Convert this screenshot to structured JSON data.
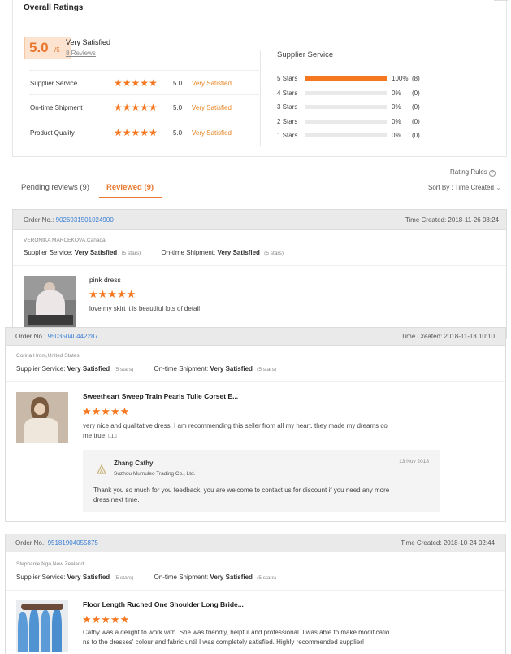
{
  "overall": {
    "title": "Overall Ratings",
    "score": "5.0",
    "score_suffix": "/5",
    "verdict": "Very Satisfied",
    "reviews_count": "8 Reviews",
    "dimensions": [
      {
        "label": "Supplier Service",
        "stars": "★★★★★",
        "value": "5.0",
        "verdict": "Very Satisfied"
      },
      {
        "label": "On-time Shipment",
        "stars": "★★★★★",
        "value": "5.0",
        "verdict": "Very Satisfied"
      },
      {
        "label": "Product Quality",
        "stars": "★★★★★",
        "value": "5.0",
        "verdict": "Very Satisfied"
      }
    ]
  },
  "supplier_service": {
    "title": "Supplier Service",
    "rows": [
      {
        "label": "5 Stars",
        "fraction": 1.0,
        "pct": "100%",
        "count": "(8)"
      },
      {
        "label": "4 Stars",
        "fraction": 0,
        "pct": "0%",
        "count": "(0)"
      },
      {
        "label": "3 Stars",
        "fraction": 0,
        "pct": "0%",
        "count": "(0)"
      },
      {
        "label": "2 Stars",
        "fraction": 0,
        "pct": "0%",
        "count": "(0)"
      },
      {
        "label": "1 Stars",
        "fraction": 0,
        "pct": "0%",
        "count": "(0)"
      }
    ]
  },
  "rating_rules": "Rating Rules",
  "rating_rules_icon": "?",
  "tabs": {
    "pending": "Pending reviews (9)",
    "reviewed": "Reviewed (9)"
  },
  "sort": {
    "label": "Sort By : Time Created",
    "chevron": "⌄"
  },
  "reviews": [
    {
      "order_label": "Order No.:",
      "order_no": "9026931501024900",
      "time": "Time Created: 2018-11-26 08:24",
      "reviewer": "VERONIKA MARCEKOVA,Canada",
      "ss_label": "Supplier Service:",
      "ss_value": "Very Satisfied",
      "ss_stars": "(5 stars)",
      "os_label": "On-time Shipment:",
      "os_value": "Very Satisfied",
      "os_stars": "(5 stars)",
      "product": "pink dress",
      "stars": "★★★★★",
      "comment": "love my skirt it is beautiful lots of detail"
    },
    {
      "order_label": "Order No.:",
      "order_no": "95035040442287",
      "time": "Time Created: 2018-11-13 10:10",
      "reviewer": "Corina Hrom,United States",
      "ss_label": "Supplier Service:",
      "ss_value": "Very Satisfied",
      "ss_stars": "(5 stars)",
      "os_label": "On-time Shipment:",
      "os_value": "Very Satisfied",
      "os_stars": "(5 stars)",
      "product": "Sweetheart Sweep Train Pearls Tulle Corset E...",
      "stars": "★★★★★",
      "comment_l1": "very nice and qualitative dress. I am recommending this seller from all my heart. they made my dreams co",
      "comment_l2": "me true. □□",
      "reply": {
        "name": "Zhang Cathy",
        "date": "13 Nov 2018",
        "company": "Suzhou Mumuleo Trading Co., Ltd.",
        "text_l1": "Thank  you so much for you feedback, you are welcome to contact us for discount if you need any more",
        "text_l2": "dress next time."
      }
    },
    {
      "order_label": "Order No.:",
      "order_no": "95181904055875",
      "time": "Time Created: 2018-10-24 02:44",
      "reviewer": "Stephanie Ngo,New Zealand",
      "ss_label": "Supplier Service:",
      "ss_value": "Very Satisfied",
      "ss_stars": "(5 stars)",
      "os_label": "On-time Shipment:",
      "os_value": "Very Satisfied",
      "os_stars": "(5 stars)",
      "product": "Floor Length Ruched One Shoulder Long Bride...",
      "stars": "★★★★★",
      "comment_l1": "Cathy was a delight to work with. She was friendly, helpful and professional. I was able to make modificatio",
      "comment_l2": "ns to the dresses' colour and fabric until I was completely satisfied. Highly recommended supplier!"
    }
  ],
  "colors": {
    "accent": "#f5771f",
    "link": "#3a7fd5",
    "score_bg": "#fbe3cf"
  }
}
